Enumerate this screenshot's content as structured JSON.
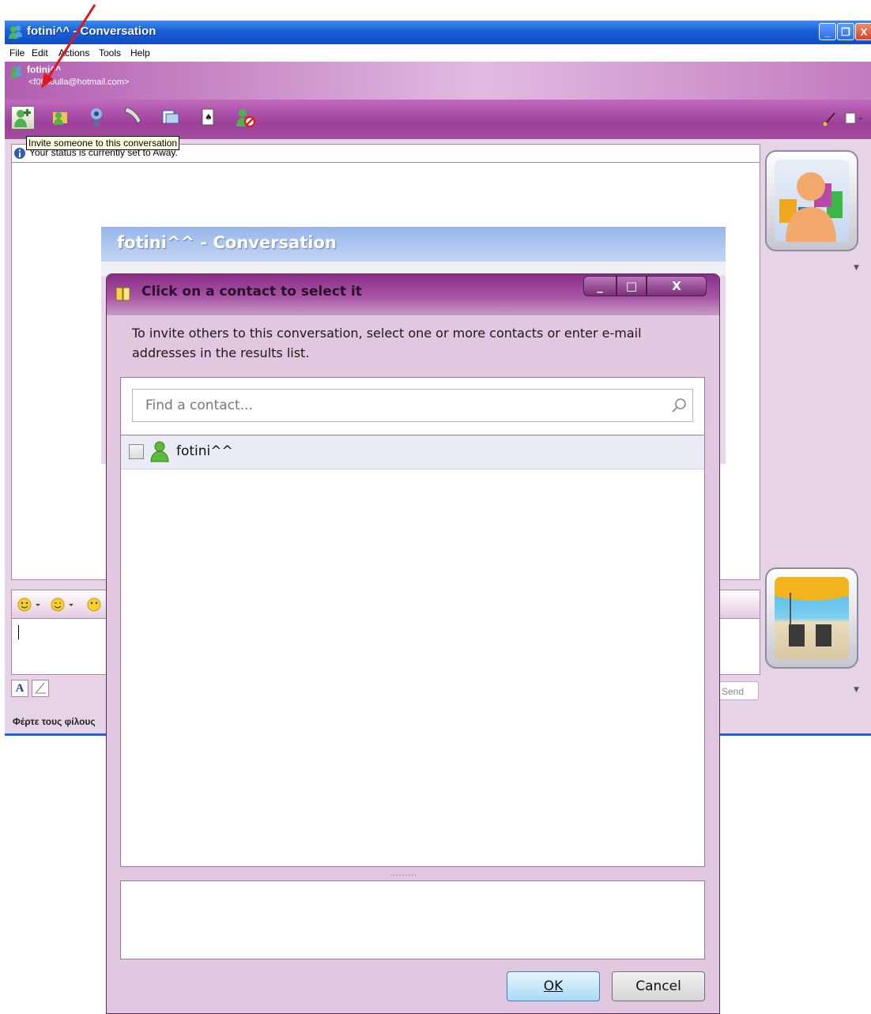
{
  "main_window": {
    "title": "fotini^^ - Conversation",
    "menu": [
      "File",
      "Edit",
      "Actions",
      "Tools",
      "Help"
    ],
    "contact_name": "fotini^^",
    "contact_email": "<f0tin0ulla@hotmail.com>",
    "tooltip": "Invite someone to this conversation",
    "info_message": "Your status is currently set to Away.",
    "send_label": "Send",
    "status_bar_text": "Φέρτε τους φίλους",
    "controls": {
      "minimize": "_",
      "restore": "❐",
      "close": "X"
    }
  },
  "background_window": {
    "title": "fotini^^ - Conversation"
  },
  "dialog": {
    "title": "Click on a contact to select it",
    "instruction": "To invite others to this conversation, select one or more contacts or enter e-mail addresses in the results list.",
    "search_placeholder": "Find a contact...",
    "contacts": [
      {
        "name": "fotini^^",
        "checked": false
      }
    ],
    "splitter": ".........",
    "ok_label": "OK",
    "cancel_label": "Cancel",
    "controls": {
      "minimize": "_",
      "maximize": "□",
      "close": "X"
    }
  },
  "colors": {
    "xp_title_blue": "#1b5fd6",
    "msn_purple": "#9d3f99",
    "dialog_bg": "#e2c7e0",
    "annotation_red": "#e0161b"
  }
}
